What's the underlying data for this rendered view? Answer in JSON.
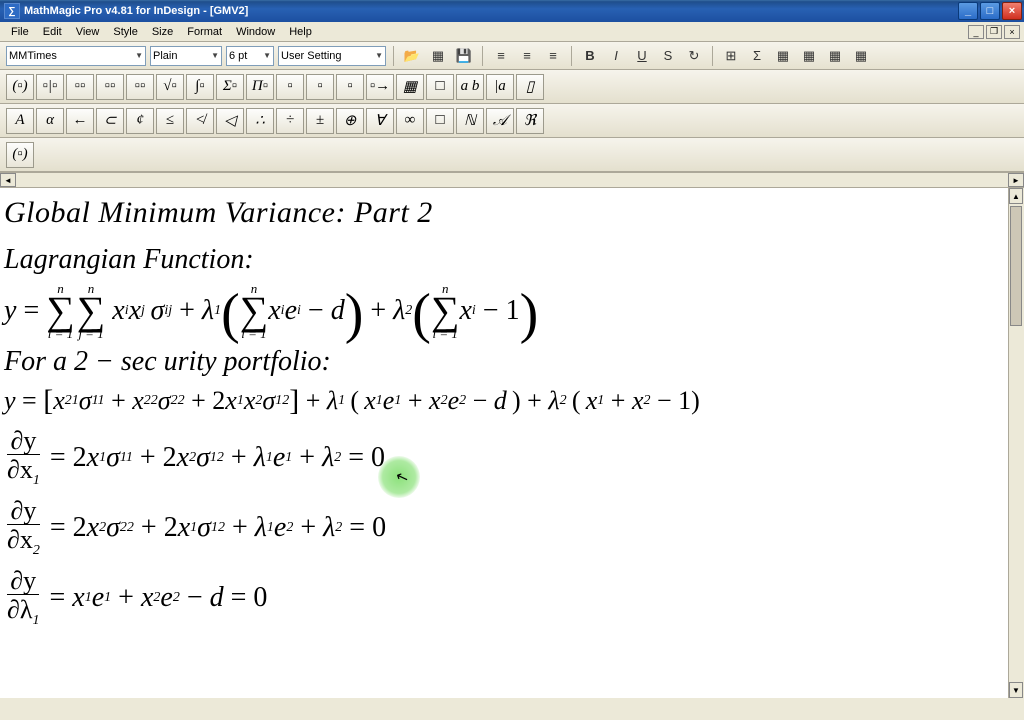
{
  "title": "MathMagic Pro v4.81 for InDesign - [GMV2]",
  "menu": {
    "items": [
      "File",
      "Edit",
      "View",
      "Style",
      "Size",
      "Format",
      "Window",
      "Help"
    ]
  },
  "mdi": {
    "min": "_",
    "restore": "❐",
    "close": "×"
  },
  "winbuttons": {
    "min": "_",
    "max": "□",
    "close": "×"
  },
  "toolbar": {
    "font": "MMTimes",
    "style": "Plain",
    "size": "6 pt",
    "setting": "User Setting"
  },
  "toolicons": {
    "open": "📂",
    "color": "▦",
    "save": "💾",
    "alignL": "≡",
    "alignC": "≡",
    "alignR": "≡",
    "bold": "B",
    "italic": "I",
    "underline": "U",
    "strike": "S",
    "redo": "↻",
    "p1": "⊞",
    "p2": "Σ",
    "p3": "▦",
    "p4": "▦",
    "p5": "▦",
    "p6": "▦"
  },
  "palette1": [
    "(▫)",
    "▫|▫",
    "▫▫",
    "▫▫",
    "▫▫",
    "√▫",
    "∫▫",
    "Σ▫",
    "Π▫",
    "▫",
    "▫",
    "▫",
    "▫→",
    "▦",
    "□",
    "a b",
    "|a",
    "▯"
  ],
  "palette2": [
    "A",
    "α",
    "←",
    "⊂",
    "¢",
    "≤",
    "≮",
    "◁",
    "∴",
    "÷",
    "±",
    "⊕",
    "∀",
    "∞",
    "□",
    "ℕ",
    "𝒜",
    "ℜ"
  ],
  "subpal": "(▫)",
  "doc": {
    "title_line": "Global Minimum Variance: Part 2",
    "lagr_label": "Lagrangian Function:",
    "for2sec": "For a 2 − sec urity portfolio:",
    "sum_top": "n",
    "sum_bi": "i = 1",
    "sum_bj": "j = 1",
    "body_xx": "x",
    "sig": "σ",
    "lam": "λ",
    "e": "e",
    "d": "d",
    "minus": "−",
    "plus": "+",
    "eq": "=",
    "one": "1",
    "two": "2",
    "zero": "0",
    "y": "y",
    "dy": "∂y",
    "dx1": "∂x",
    "dl": "∂λ",
    "i": "i",
    "j": "j",
    "s1": "1",
    "s2": "2",
    "s11": "11",
    "s12": "12",
    "s22": "22",
    "sij": "ij"
  }
}
